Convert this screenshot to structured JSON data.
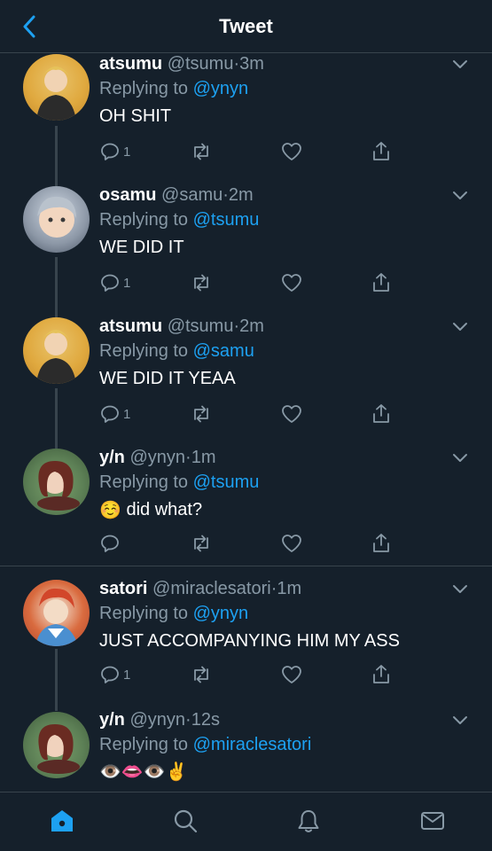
{
  "header": {
    "title": "Tweet"
  },
  "tweets": [
    {
      "name": "atsumu",
      "handle": "@tsumu",
      "sep": "·",
      "time": "3m",
      "reply_prefix": "Replying to",
      "reply_to": "@ynyn",
      "text": "OH SHIT",
      "reply_count": "1"
    },
    {
      "name": "osamu",
      "handle": "@samu",
      "sep": "·",
      "time": "2m",
      "reply_prefix": "Replying to",
      "reply_to": "@tsumu",
      "text": "WE DID IT",
      "reply_count": "1"
    },
    {
      "name": "atsumu",
      "handle": "@tsumu",
      "sep": "·",
      "time": "2m",
      "reply_prefix": "Replying to",
      "reply_to": "@samu",
      "text": "WE DID IT YEAA",
      "reply_count": "1"
    },
    {
      "name": "y/n",
      "handle": "@ynyn",
      "sep": "·",
      "time": "1m",
      "reply_prefix": "Replying to",
      "reply_to": "@tsumu",
      "text": "did what?",
      "reply_count": ""
    },
    {
      "name": "satori",
      "handle": "@miraclesatori",
      "sep": "·",
      "time": "1m",
      "reply_prefix": "Replying to",
      "reply_to": "@ynyn",
      "text": "JUST ACCOMPANYING HIM MY ASS",
      "reply_count": "1"
    },
    {
      "name": "y/n",
      "handle": "@ynyn",
      "sep": "·",
      "time": "12s",
      "reply_prefix": "Replying to",
      "reply_to": "@miraclesatori",
      "text": "👁️👄👁️✌️",
      "reply_count": ""
    }
  ],
  "emoji": {
    "relieved": "☺️"
  },
  "nav": {
    "active": "home",
    "items": [
      "home-icon",
      "search-icon",
      "notifications-icon",
      "messages-icon"
    ]
  },
  "colors": {
    "background": "#15202b",
    "accent": "#1da1f2",
    "muted": "#8899a6",
    "divider": "#38444d"
  }
}
